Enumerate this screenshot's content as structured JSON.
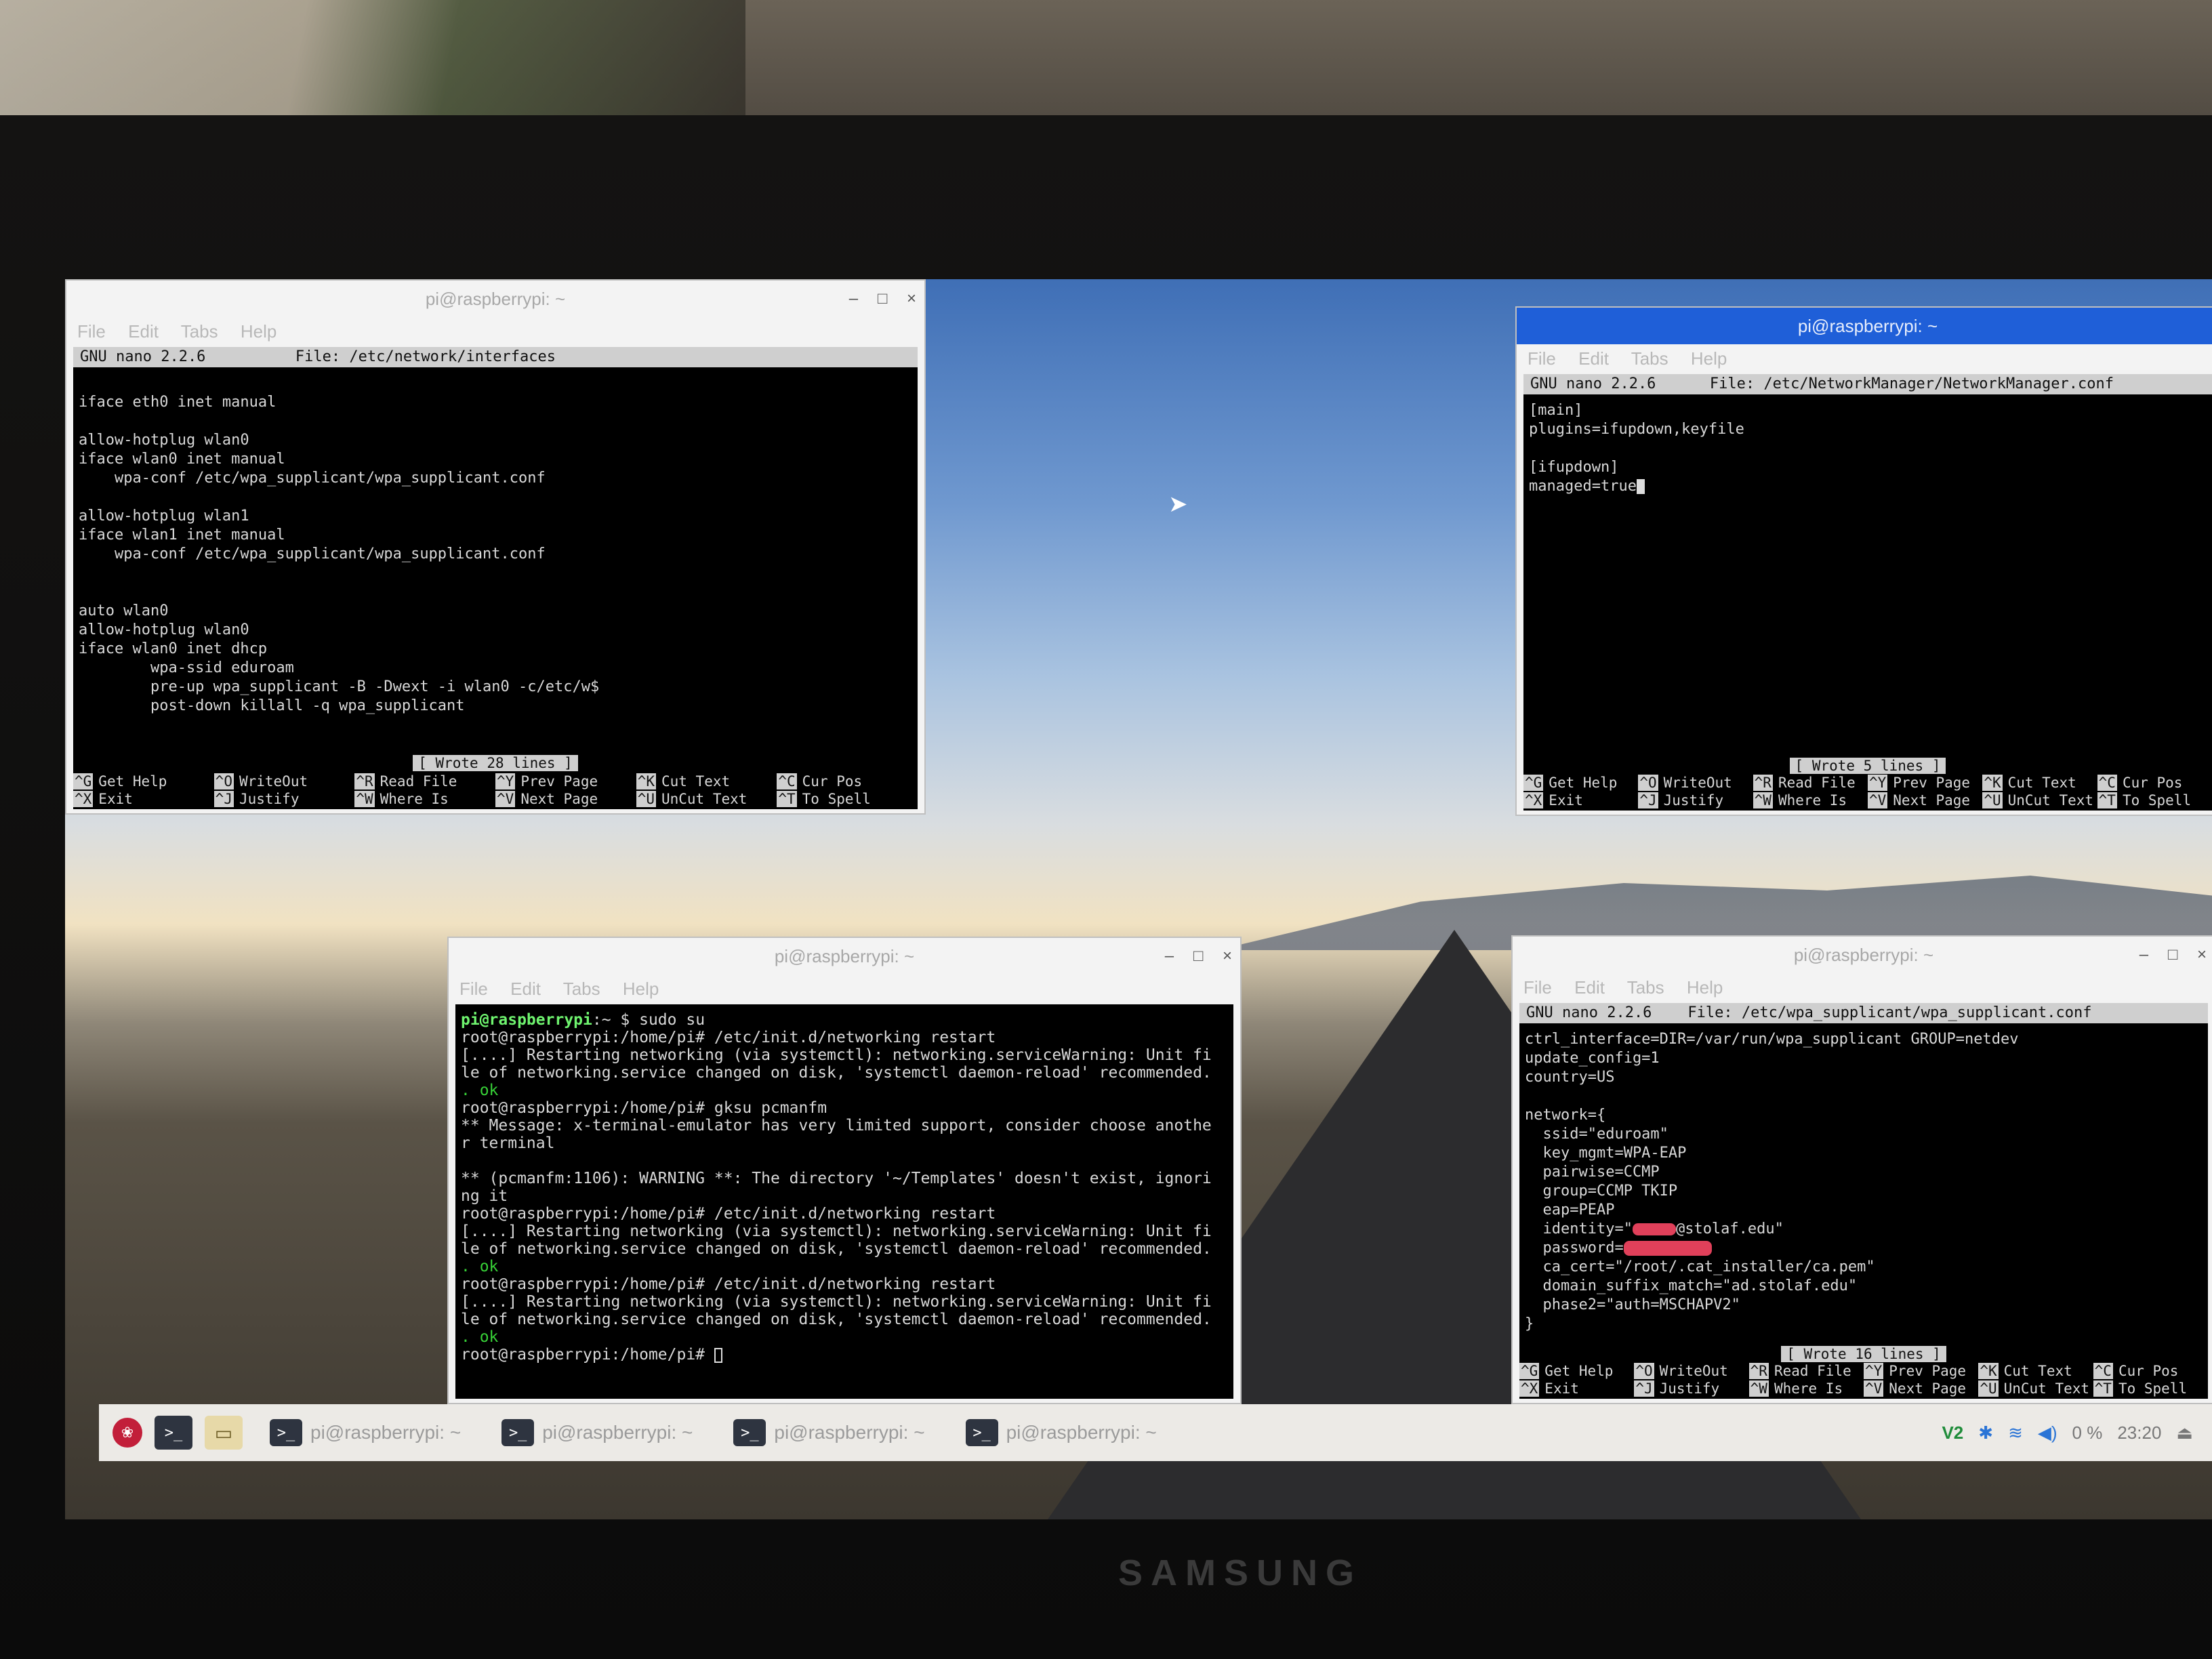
{
  "monitor": {
    "brand": "SAMSUNG"
  },
  "window_top_left": {
    "title": "pi@raspberrypi: ~",
    "controls": [
      "–",
      "□",
      "×"
    ],
    "menu": [
      "File",
      "Edit",
      "Tabs",
      "Help"
    ],
    "nano_version": "GNU nano 2.2.6",
    "file": "File: /etc/network/interfaces",
    "lines": [
      "",
      "iface eth0 inet manual",
      "",
      "allow-hotplug wlan0",
      "iface wlan0 inet manual",
      "    wpa-conf /etc/wpa_supplicant/wpa_supplicant.conf",
      "",
      "allow-hotplug wlan1",
      "iface wlan1 inet manual",
      "    wpa-conf /etc/wpa_supplicant/wpa_supplicant.conf",
      "",
      "",
      "auto wlan0",
      "allow-hotplug wlan0",
      "iface wlan0 inet dhcp",
      "        wpa-ssid eduroam",
      "        pre-up wpa_supplicant -B -Dwext -i wlan0 -c/etc/w$",
      "        post-down killall -q wpa_supplicant"
    ],
    "status": "[ Wrote 28 lines ]",
    "keys_row1": [
      {
        "k": "^G",
        "label": "Get Help"
      },
      {
        "k": "^O",
        "label": "WriteOut"
      },
      {
        "k": "^R",
        "label": "Read File"
      },
      {
        "k": "^Y",
        "label": "Prev Page"
      },
      {
        "k": "^K",
        "label": "Cut Text"
      },
      {
        "k": "^C",
        "label": "Cur Pos"
      }
    ],
    "keys_row2": [
      {
        "k": "^X",
        "label": "Exit"
      },
      {
        "k": "^J",
        "label": "Justify"
      },
      {
        "k": "^W",
        "label": "Where Is"
      },
      {
        "k": "^V",
        "label": "Next Page"
      },
      {
        "k": "^U",
        "label": "UnCut Text"
      },
      {
        "k": "^T",
        "label": "To Spell"
      }
    ]
  },
  "window_top_right": {
    "title": "pi@raspberrypi: ~",
    "menu": [
      "File",
      "Edit",
      "Tabs",
      "Help"
    ],
    "nano_version": "GNU nano 2.2.6",
    "file": "File: /etc/NetworkManager/NetworkManager.conf",
    "lines": [
      "[main]",
      "plugins=ifupdown,keyfile",
      "",
      "[ifupdown]",
      "managed=true"
    ],
    "status": "[ Wrote 5 lines ]",
    "keys_row1": [
      {
        "k": "^G",
        "label": "Get Help"
      },
      {
        "k": "^O",
        "label": "WriteOut"
      },
      {
        "k": "^R",
        "label": "Read File"
      },
      {
        "k": "^Y",
        "label": "Prev Page"
      },
      {
        "k": "^K",
        "label": "Cut Text"
      },
      {
        "k": "^C",
        "label": "Cur Pos"
      }
    ],
    "keys_row2": [
      {
        "k": "^X",
        "label": "Exit"
      },
      {
        "k": "^J",
        "label": "Justify"
      },
      {
        "k": "^W",
        "label": "Where Is"
      },
      {
        "k": "^V",
        "label": "Next Page"
      },
      {
        "k": "^U",
        "label": "UnCut Text"
      },
      {
        "k": "^T",
        "label": "To Spell"
      }
    ]
  },
  "window_bottom_center": {
    "title": "pi@raspberrypi: ~",
    "controls": [
      "–",
      "□",
      "×"
    ],
    "menu": [
      "File",
      "Edit",
      "Tabs",
      "Help"
    ],
    "prompt_user": "pi@raspberrypi",
    "prompt_rest": ":~ $ sudo su",
    "lines": [
      "root@raspberrypi:/home/pi# /etc/init.d/networking restart",
      "[....] Restarting networking (via systemctl): networking.serviceWarning: Unit fi",
      "le of networking.service changed on disk, 'systemctl daemon-reload' recommended.",
      "@ok",
      "root@raspberrypi:/home/pi# gksu pcmanfm",
      "** Message: x-terminal-emulator has very limited support, consider choose anothe",
      "r terminal",
      "",
      "** (pcmanfm:1106): WARNING **: The directory '~/Templates' doesn't exist, ignori",
      "ng it",
      "root@raspberrypi:/home/pi# /etc/init.d/networking restart",
      "[....] Restarting networking (via systemctl): networking.serviceWarning: Unit fi",
      "le of networking.service changed on disk, 'systemctl daemon-reload' recommended.",
      "@ok",
      "root@raspberrypi:/home/pi# /etc/init.d/networking restart",
      "[....] Restarting networking (via systemctl): networking.serviceWarning: Unit fi",
      "le of networking.service changed on disk, 'systemctl daemon-reload' recommended.",
      "@ok",
      "root@raspberrypi:/home/pi# "
    ],
    "ok_text": ". ok"
  },
  "window_bottom_right": {
    "title": "pi@raspberrypi: ~",
    "controls": [
      "–",
      "□",
      "×"
    ],
    "menu": [
      "File",
      "Edit",
      "Tabs",
      "Help"
    ],
    "nano_version": "GNU nano 2.2.6",
    "file": "File: /etc/wpa_supplicant/wpa_supplicant.conf",
    "lines": [
      "ctrl_interface=DIR=/var/run/wpa_supplicant GROUP=netdev",
      "update_config=1",
      "country=US",
      "",
      "network={",
      "  ssid=\"eduroam\"",
      "  key_mgmt=WPA-EAP",
      "  pairwise=CCMP",
      "  group=CCMP TKIP",
      "  eap=PEAP"
    ],
    "identity_prefix": "  identity=\"",
    "identity_suffix": "@stolaf.edu\"",
    "password_prefix": "  password=",
    "lines_after": [
      "  ca_cert=\"/root/.cat_installer/ca.pem\"",
      "  domain_suffix_match=\"ad.stolaf.edu\"",
      "  phase2=\"auth=MSCHAPV2\"",
      "}"
    ],
    "status": "[ Wrote 16 lines ]",
    "keys_row1": [
      {
        "k": "^G",
        "label": "Get Help"
      },
      {
        "k": "^O",
        "label": "WriteOut"
      },
      {
        "k": "^R",
        "label": "Read File"
      },
      {
        "k": "^Y",
        "label": "Prev Page"
      },
      {
        "k": "^K",
        "label": "Cut Text"
      },
      {
        "k": "^C",
        "label": "Cur Pos"
      }
    ],
    "keys_row2": [
      {
        "k": "^X",
        "label": "Exit"
      },
      {
        "k": "^J",
        "label": "Justify"
      },
      {
        "k": "^W",
        "label": "Where Is"
      },
      {
        "k": "^V",
        "label": "Next Page"
      },
      {
        "k": "^U",
        "label": "UnCut Text"
      },
      {
        "k": "^T",
        "label": "To Spell"
      }
    ]
  },
  "taskbar": {
    "tasks": [
      "pi@raspberrypi: ~",
      "pi@raspberrypi: ~",
      "pi@raspberrypi: ~",
      "pi@raspberrypi: ~"
    ],
    "tray": {
      "vnc": "V2",
      "cpu": "0 %",
      "clock": "23:20"
    }
  }
}
